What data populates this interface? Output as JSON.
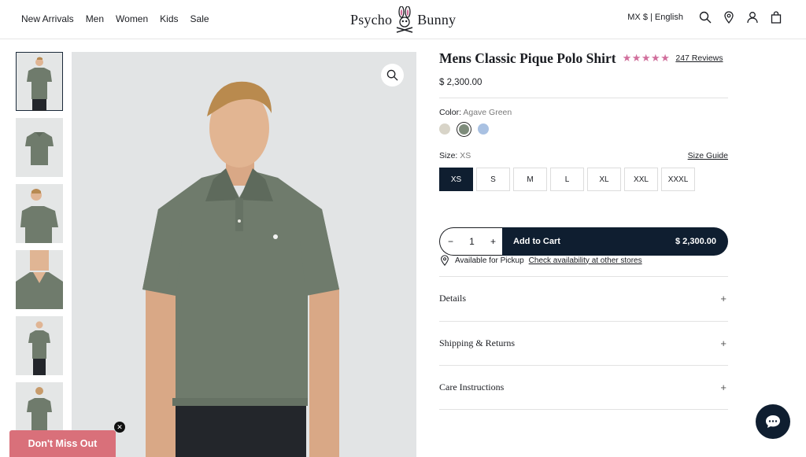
{
  "header": {
    "nav": [
      "New Arrivals",
      "Men",
      "Women",
      "Kids",
      "Sale"
    ],
    "logo_left": "Psycho",
    "logo_right": "Bunny",
    "locale": "MX $ | English",
    "icons": [
      "search-icon",
      "location-icon",
      "account-icon",
      "cart-icon"
    ]
  },
  "product": {
    "title": "Mens Classic Pique Polo Shirt",
    "stars": "★★★★★",
    "rating": 5,
    "reviews": "247 Reviews",
    "price": "$ 2,300.00",
    "color_label": "Color:",
    "color_value": "Agave Green",
    "swatches": [
      "#d8d4c8",
      "#7e8c7b",
      "#a9c1e2"
    ],
    "selected_swatch": 1,
    "size_label": "Size:",
    "size_value": "XS",
    "size_guide": "Size Guide",
    "sizes": [
      "XS",
      "S",
      "M",
      "L",
      "XL",
      "XXL",
      "XXXL"
    ],
    "selected_size": "XS"
  },
  "cart": {
    "minus": "−",
    "qty": "1",
    "plus": "+",
    "add_label": "Add to Cart",
    "add_price": "$ 2,300.00"
  },
  "pickup": {
    "text": "Available for Pickup",
    "link": "Check availability at other stores"
  },
  "accordion": [
    {
      "title": "Details",
      "icon": "+"
    },
    {
      "title": "Shipping & Returns",
      "icon": "+"
    },
    {
      "title": "Care Instructions",
      "icon": "+"
    }
  ],
  "promo": {
    "label": "Don't Miss Out",
    "close": "✕"
  },
  "colors": {
    "navy": "#0f1e30",
    "star_pink": "#d16f9c",
    "promo_pink": "#d9707a",
    "shirt_green": "#6f7b6c"
  }
}
